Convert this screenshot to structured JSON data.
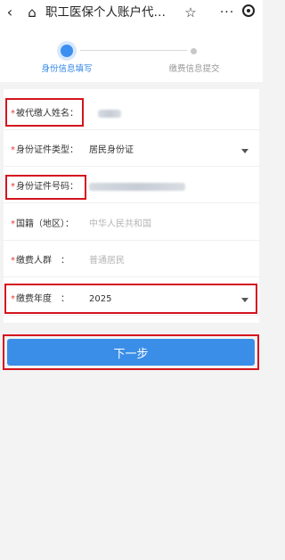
{
  "header": {
    "back_icon": "‹",
    "home_icon": "⌂",
    "title": "职工医保个人账户代…",
    "star_icon": "☆",
    "more_icon": "···"
  },
  "stepper": {
    "steps": [
      {
        "label": "身份信息填写"
      },
      {
        "label": "缴费信息提交"
      }
    ]
  },
  "form": {
    "fields": [
      {
        "label": "被代缴人姓名：",
        "required_mark": "*",
        "value": ""
      },
      {
        "label": "身份证件类型：",
        "required_mark": "*",
        "value": "居民身份证"
      },
      {
        "label": "身份证件号码：",
        "required_mark": "*",
        "value": ""
      },
      {
        "label": "国籍（地区）：",
        "required_mark": "*",
        "value": "中华人民共和国"
      },
      {
        "label": "缴费人群　：",
        "required_mark": "*",
        "value": "普通居民"
      },
      {
        "label": "缴费年度　：",
        "required_mark": "*",
        "value": "2025"
      }
    ]
  },
  "next_button": {
    "label": "下一步"
  },
  "colors": {
    "accent": "#3a8ee8",
    "highlight": "#d4141e",
    "required": "#e53935"
  }
}
